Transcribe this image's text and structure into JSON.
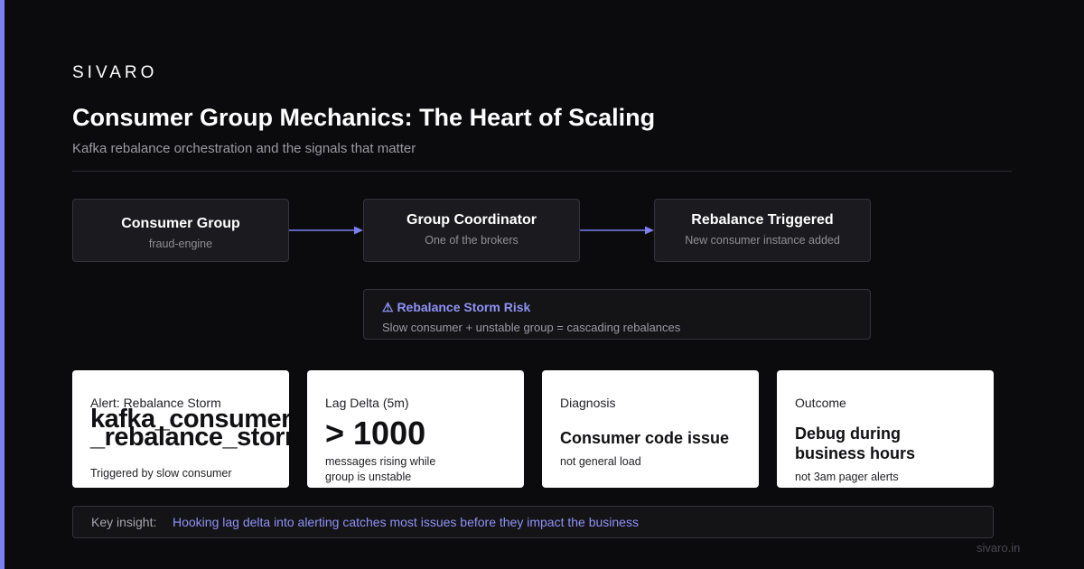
{
  "brand": "SIVARO",
  "title": "Consumer Group Mechanics: The Heart of Scaling",
  "subtitle": "Kafka rebalance orchestration and the signals that matter",
  "flow": [
    {
      "title": "Consumer Group",
      "subtitle": "fraud-engine"
    },
    {
      "title": "Group Coordinator",
      "subtitle": "One of the brokers"
    },
    {
      "title": "Rebalance Triggered",
      "subtitle": "New consumer instance added"
    }
  ],
  "risk": {
    "title": "⚠ Rebalance Storm Risk",
    "description": "Slow consumer + unstable group = cascading rebalances"
  },
  "cards": [
    {
      "label": "Alert: Rebalance Storm",
      "value_line1": "kafka_consumer",
      "value_line2": "_rebalance_storm",
      "footer": "Triggered by slow consumer"
    },
    {
      "label": "Lag Delta (5m)",
      "value": "> 1000",
      "footer": "messages rising while group is unstable"
    },
    {
      "label": "Diagnosis",
      "value": "Consumer code issue",
      "footer": "not general load"
    },
    {
      "label": "Outcome",
      "value": "Debug during business hours",
      "footer": "not 3am pager alerts"
    }
  ],
  "insight": {
    "label": "Key insight:",
    "text": "Hooking lag delta into alerting catches most issues before they impact the business"
  },
  "footer": "sivaro.in",
  "colors": {
    "accent": "#7b7ff0",
    "background": "#0b0b0d",
    "box_fill": "#1b1b1f",
    "card_fill": "#ffffff"
  }
}
